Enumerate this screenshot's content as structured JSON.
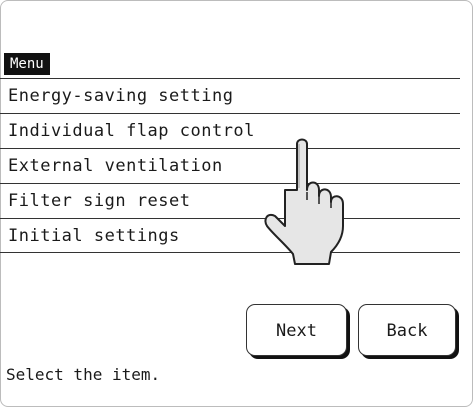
{
  "menu": {
    "title": "Menu",
    "items": [
      {
        "label": "Energy-saving setting"
      },
      {
        "label": "Individual flap control"
      },
      {
        "label": "External ventilation"
      },
      {
        "label": "Filter sign reset"
      },
      {
        "label": "Initial settings"
      }
    ]
  },
  "buttons": {
    "next_label": "Next",
    "back_label": "Back"
  },
  "status": {
    "text": "Select the item."
  },
  "icons": {
    "pointer": "hand-pointer-icon"
  },
  "colors": {
    "title_background": "#111111",
    "title_text": "#ffffff",
    "divider": "#333333",
    "hand_fill": "#e6e6e6"
  }
}
